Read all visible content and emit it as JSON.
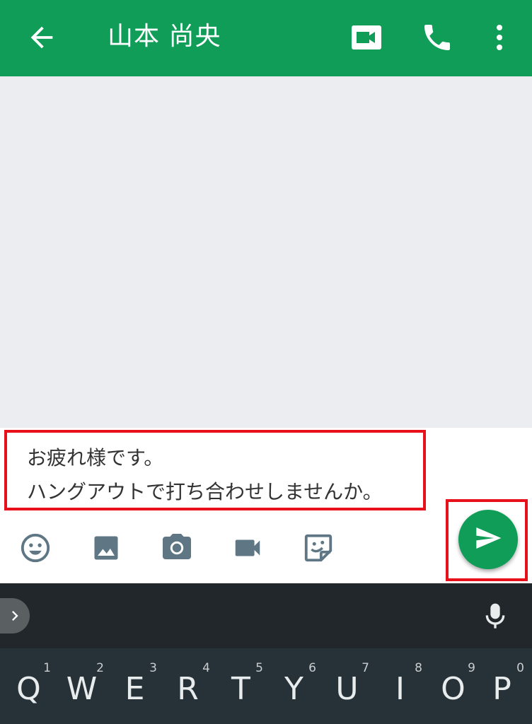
{
  "header": {
    "title": "山本 尚央",
    "back_icon": "arrow-back-icon",
    "actions": [
      "video-call-icon",
      "phone-icon",
      "more-vert-icon"
    ]
  },
  "compose": {
    "message_lines": [
      "お疲れ様です。",
      "ハングアウトで打ち合わせしませんか。"
    ],
    "message_text": "お疲れ様です。\nハングアウトで打ち合わせしませんか。",
    "tools": [
      "emoji-icon",
      "image-icon",
      "camera-icon",
      "video-icon",
      "sticker-icon"
    ],
    "send_icon": "send-icon"
  },
  "keyboard": {
    "expand_icon": "chevron-right-icon",
    "mic_icon": "mic-icon",
    "keys": [
      {
        "letter": "Q",
        "number": "1"
      },
      {
        "letter": "W",
        "number": "2"
      },
      {
        "letter": "E",
        "number": "3"
      },
      {
        "letter": "R",
        "number": "4"
      },
      {
        "letter": "T",
        "number": "5"
      },
      {
        "letter": "Y",
        "number": "6"
      },
      {
        "letter": "U",
        "number": "7"
      },
      {
        "letter": "I",
        "number": "8"
      },
      {
        "letter": "O",
        "number": "9"
      },
      {
        "letter": "P",
        "number": "0"
      }
    ]
  },
  "colors": {
    "appbar": "#0f9d58",
    "highlight": "#e8101a",
    "tool_icon": "#5f7684",
    "keyboard": "#263238"
  }
}
